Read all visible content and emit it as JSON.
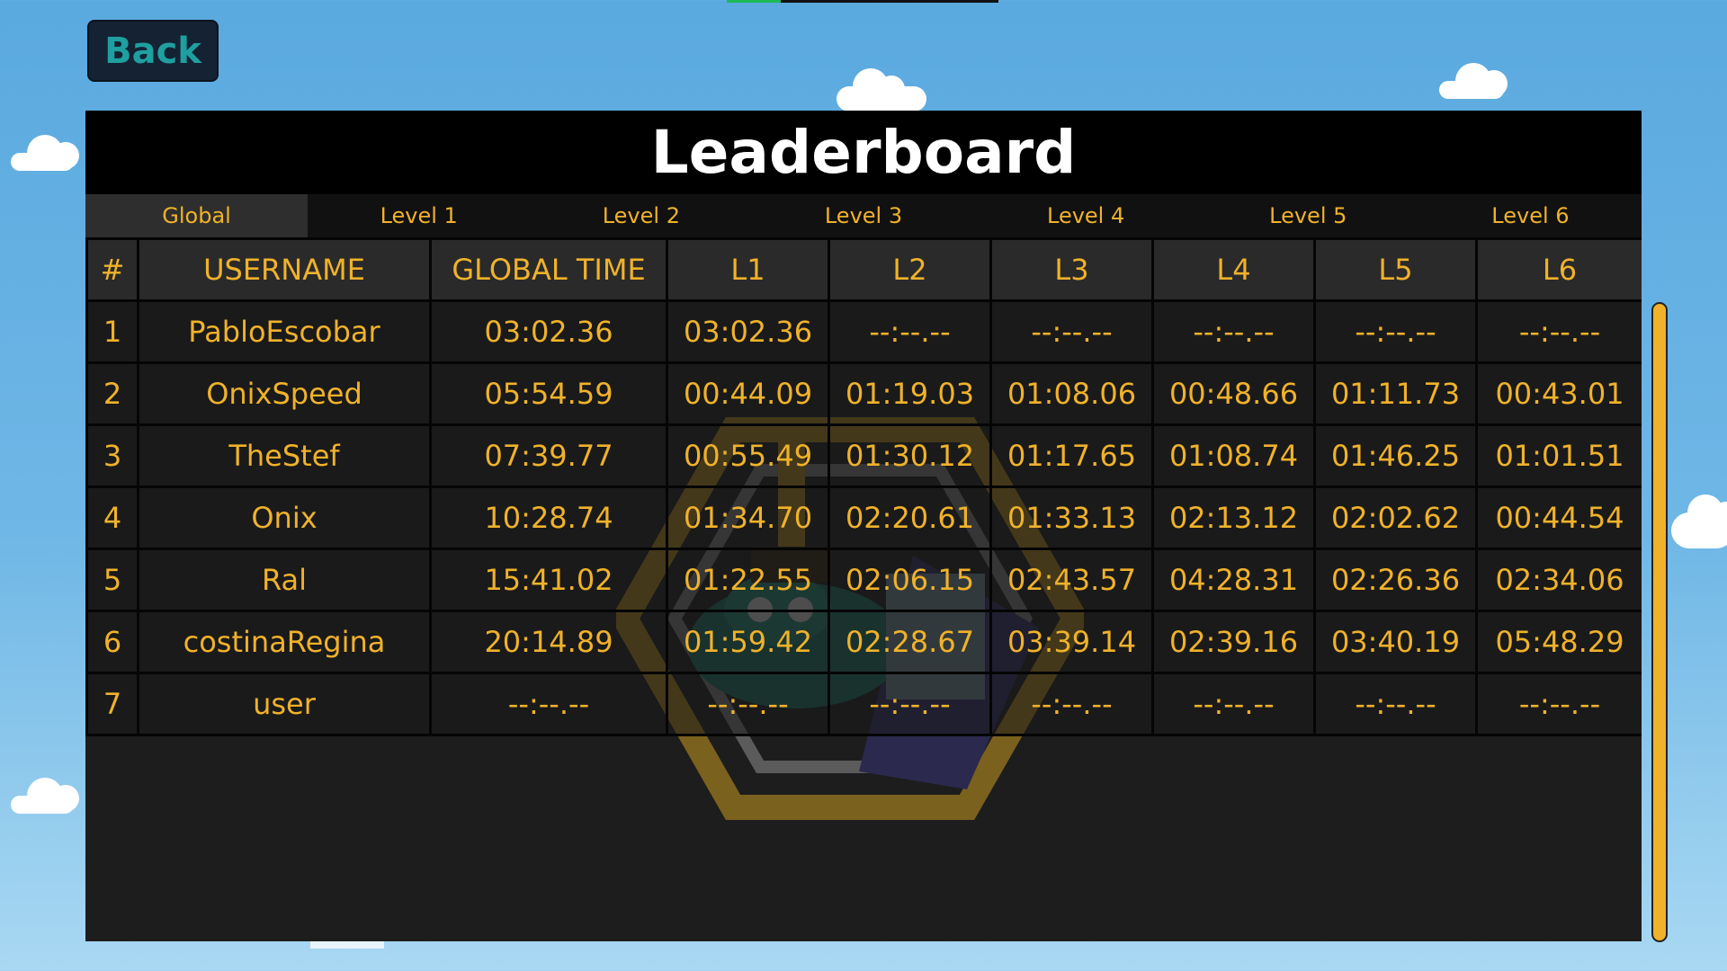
{
  "back_label": "Back",
  "title": "Leaderboard",
  "tabs": [
    "Global",
    "Level 1",
    "Level 2",
    "Level 3",
    "Level 4",
    "Level 5",
    "Level 6"
  ],
  "active_tab": "Global",
  "columns": [
    "#",
    "USERNAME",
    "GLOBAL TIME",
    "L1",
    "L2",
    "L3",
    "L4",
    "L5",
    "L6"
  ],
  "rows": [
    [
      "1",
      "PabloEscobar",
      "03:02.36",
      "03:02.36",
      "--:--.--",
      "--:--.--",
      "--:--.--",
      "--:--.--",
      "--:--.--"
    ],
    [
      "2",
      "OnixSpeed",
      "05:54.59",
      "00:44.09",
      "01:19.03",
      "01:08.06",
      "00:48.66",
      "01:11.73",
      "00:43.01"
    ],
    [
      "3",
      "TheStef",
      "07:39.77",
      "00:55.49",
      "01:30.12",
      "01:17.65",
      "01:08.74",
      "01:46.25",
      "01:01.51"
    ],
    [
      "4",
      "Onix",
      "10:28.74",
      "01:34.70",
      "02:20.61",
      "01:33.13",
      "02:13.12",
      "02:02.62",
      "00:44.54"
    ],
    [
      "5",
      "Ral",
      "15:41.02",
      "01:22.55",
      "02:06.15",
      "02:43.57",
      "04:28.31",
      "02:26.36",
      "02:34.06"
    ],
    [
      "6",
      "costinaRegina",
      "20:14.89",
      "01:59.42",
      "02:28.67",
      "03:39.14",
      "02:39.16",
      "03:40.19",
      "05:48.29"
    ],
    [
      "7",
      "user",
      "--:--.--",
      "--:--.--",
      "--:--.--",
      "--:--.--",
      "--:--.--",
      "--:--.--",
      "--:--.--"
    ]
  ],
  "colors": {
    "accent": "#f0b22a",
    "back_text": "#1f9fa0",
    "panel": "#1d1d1d",
    "sky": "#5aa9df"
  }
}
